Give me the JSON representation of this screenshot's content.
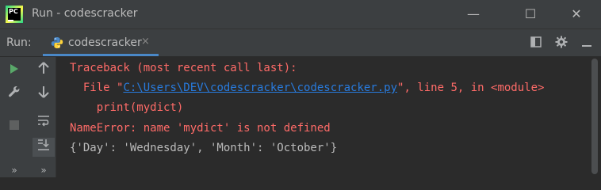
{
  "window": {
    "title": "Run - codescracker",
    "minimize_glyph": "—",
    "maximize_glyph": "☐",
    "close_glyph": "✕"
  },
  "app_icon": {
    "name": "pycharm-icon",
    "label": "PC"
  },
  "run_panel": {
    "label": "Run:",
    "tab": {
      "label": "codescracker",
      "icon": "python-icon",
      "close_glyph": "×"
    }
  },
  "toolbar_icons": [
    "layout-icon",
    "gear-icon",
    "minimize-panel-icon"
  ],
  "gutter_icons": {
    "left": [
      "run-icon",
      "wrench-icon",
      "stop-icon"
    ],
    "right": [
      "arrow-up-icon",
      "arrow-down-icon",
      "soft-wrap-icon",
      "scroll-to-end-icon"
    ],
    "more_glyph": "»"
  },
  "console": {
    "traceback_header": "Traceback (most recent call last):",
    "file_prefix": "  File \"",
    "file_path": "C:\\Users\\DEV\\codescracker\\codescracker.py",
    "file_suffix": "\", line 5, in <module>",
    "code_line": "    print(mydict)",
    "error_line": "NameError: name 'mydict' is not defined",
    "output_line": "{'Day': 'Wednesday', 'Month': 'October'}"
  },
  "colors": {
    "error": "#ff6b68",
    "link": "#287bde",
    "output": "#bbbbbb",
    "run_green": "#59a869",
    "accent_tab": "#4a88c7"
  }
}
